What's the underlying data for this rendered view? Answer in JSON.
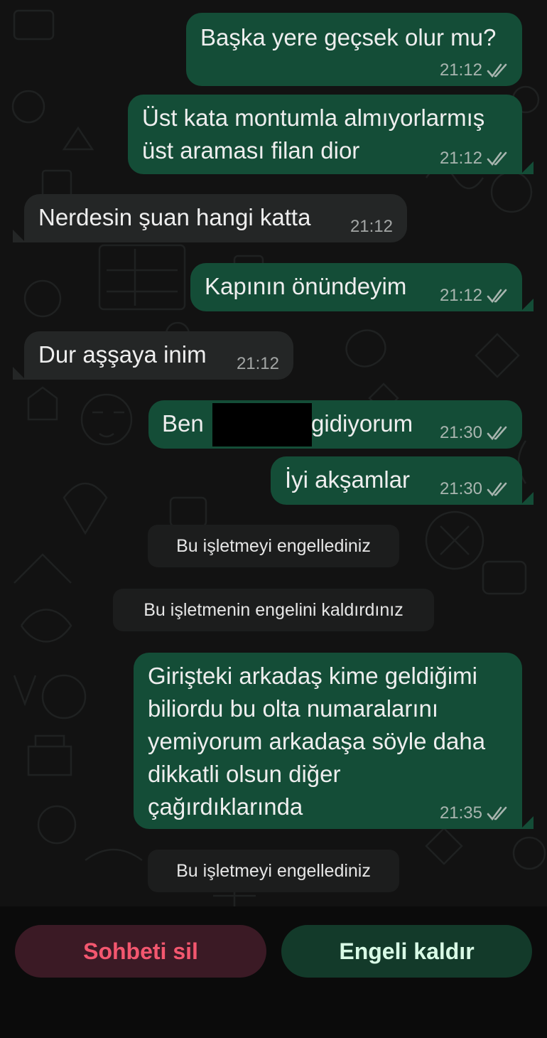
{
  "messages": [
    {
      "text": "Başka yere geçsek olur mu?",
      "time": "21:12",
      "direction": "outgoing",
      "status": "read"
    },
    {
      "text": "Üst kata montumla almıyorlarmış\nüst araması filan dior",
      "time": "21:12",
      "direction": "outgoing",
      "status": "read"
    },
    {
      "text": "Nerdesin şuan hangi katta",
      "time": "21:12",
      "direction": "incoming"
    },
    {
      "text": "Kapının önündeyim",
      "time": "21:12",
      "direction": "outgoing",
      "status": "read"
    },
    {
      "text": "Dur aşşaya inim",
      "time": "21:12",
      "direction": "incoming"
    },
    {
      "text_before": "Ben",
      "text_after": "gidiyorum",
      "redacted": true,
      "time": "21:30",
      "direction": "outgoing",
      "status": "read"
    },
    {
      "text": "İyi akşamlar",
      "time": "21:30",
      "direction": "outgoing",
      "status": "read"
    },
    {
      "text": "Girişteki arkadaş kime geldiğimi\nbiliordu bu olta numaralarını\nyemiyorum arkadaşa söyle daha\ndikkatli olsun diğer\nçağırdıklarında",
      "time": "21:35",
      "direction": "outgoing",
      "status": "read"
    }
  ],
  "system_notices": [
    "Bu işletmeyi engellediniz",
    "Bu işletmenin engelini kaldırdınız",
    "Bu işletmeyi engellediniz"
  ],
  "actions": {
    "delete_chat": "Sohbeti sil",
    "unblock": "Engeli kaldır"
  },
  "colors": {
    "outgoing_bubble": "#144d37",
    "incoming_bubble": "#242626",
    "delete_text": "#f3576f",
    "unblock_text": "#d9fbe6"
  },
  "icons": {
    "read_receipt": "double-check-icon"
  }
}
